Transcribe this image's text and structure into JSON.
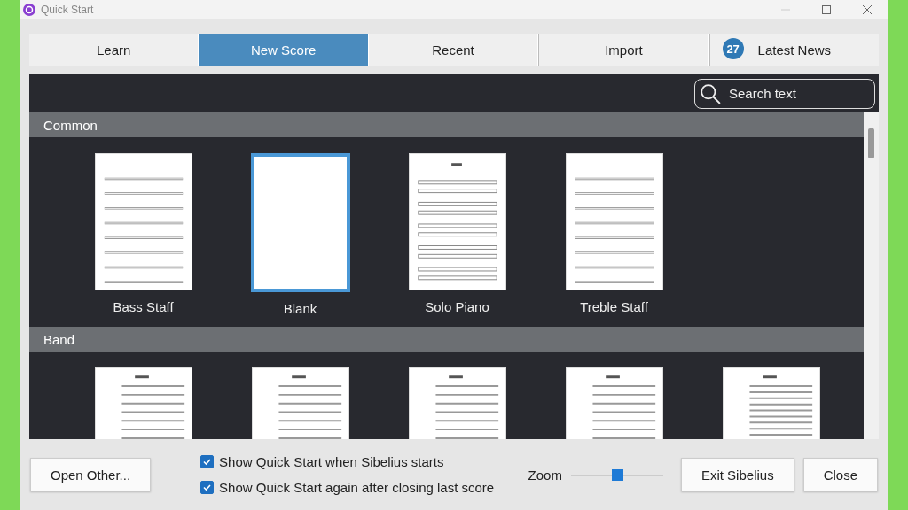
{
  "window": {
    "title": "Quick Start"
  },
  "tabs": [
    {
      "label": "Learn",
      "selected": false
    },
    {
      "label": "New Score",
      "selected": true
    },
    {
      "label": "Recent",
      "selected": false
    },
    {
      "label": "Import",
      "selected": false
    },
    {
      "label": "Latest News",
      "selected": false,
      "badge": "27"
    }
  ],
  "search": {
    "placeholder": "Search text"
  },
  "sections": [
    {
      "title": "Common",
      "items": [
        {
          "name": "Bass Staff",
          "kind": "staves",
          "selected": false
        },
        {
          "name": "Blank",
          "kind": "blank",
          "selected": true
        },
        {
          "name": "Solo Piano",
          "kind": "piano",
          "selected": false
        },
        {
          "name": "Treble Staff",
          "kind": "staves",
          "selected": false
        }
      ]
    },
    {
      "title": "Band",
      "items": [
        {
          "kind": "band",
          "selected": false
        },
        {
          "kind": "band",
          "selected": false
        },
        {
          "kind": "band",
          "selected": false
        },
        {
          "kind": "band",
          "selected": false
        },
        {
          "kind": "dense",
          "selected": false
        }
      ]
    }
  ],
  "footer": {
    "open_button": "Open Other...",
    "options": [
      {
        "label": "Show Quick Start when Sibelius starts",
        "checked": true
      },
      {
        "label": "Show Quick Start again after closing last score",
        "checked": true
      }
    ],
    "zoom": {
      "label": "Zoom",
      "level": 0.5
    },
    "buttons": [
      "Exit Sibelius",
      "Close"
    ]
  }
}
